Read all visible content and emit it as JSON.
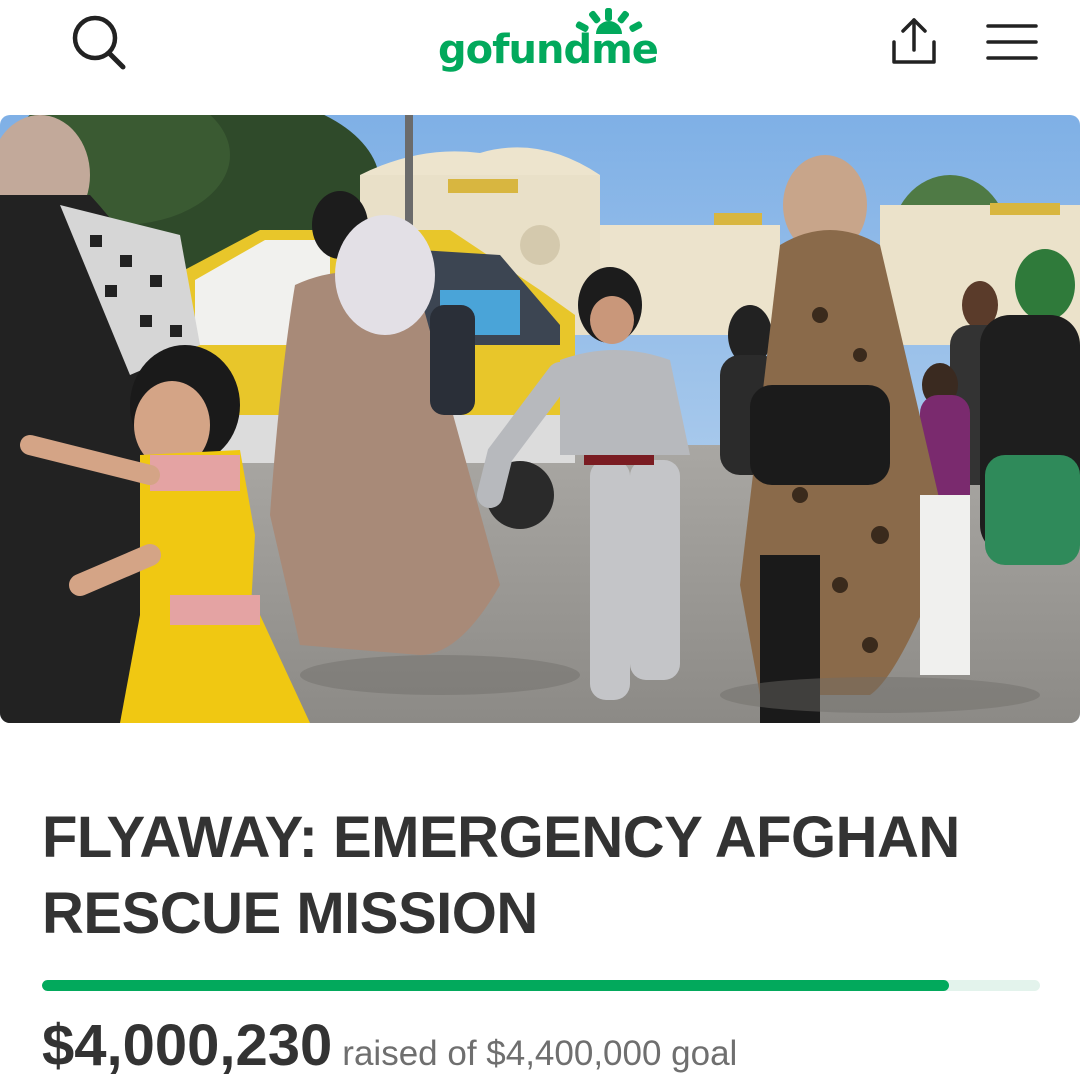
{
  "header": {
    "logo_text": "gofundme",
    "search_icon": "search-icon",
    "share_icon": "share-icon",
    "menu_icon": "hamburger-menu-icon",
    "brand_color": "#02a95c"
  },
  "campaign": {
    "title": "FLYAWAY: EMERGENCY AFGHAN RESCUE MISSION",
    "amount_raised": "$4,000,230",
    "goal_text": "raised of $4,400,000 goal",
    "progress_fraction": 0.9091
  },
  "colors": {
    "accent": "#02a95c",
    "track": "#e3f3ec",
    "title": "#333333",
    "subtext": "#6f6f6f"
  }
}
